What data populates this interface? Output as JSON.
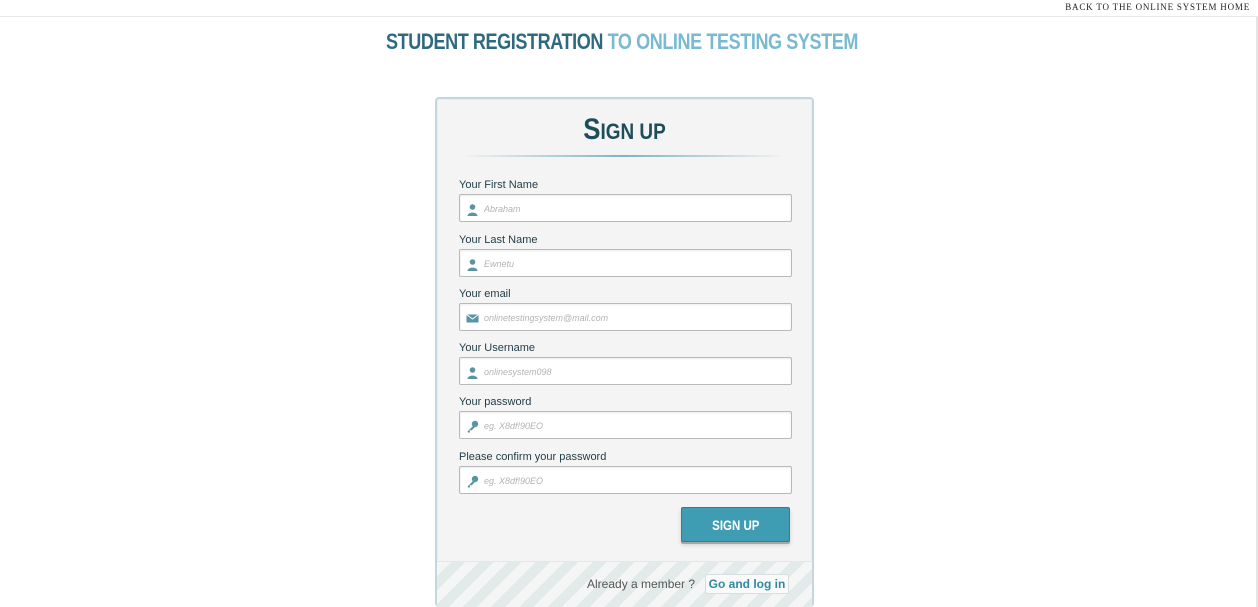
{
  "topbar": {
    "back_link": "BACK TO THE ONLINE SYSTEM HOME"
  },
  "header": {
    "title_part1": "STUDENT REGISTRATION",
    "title_part2": "TO ONLINE TESTING SYSTEM"
  },
  "form": {
    "title_big": "S",
    "title_rest": "IGN UP",
    "fields": [
      {
        "label": "Your First Name",
        "placeholder": "Abraham",
        "icon": "user-icon"
      },
      {
        "label": "Your Last Name",
        "placeholder": "Ewnetu",
        "icon": "user-icon"
      },
      {
        "label": "Your email",
        "placeholder": "onlinetestingsystem@mail.com",
        "icon": "mail-icon"
      },
      {
        "label": "Your Username",
        "placeholder": "onlinesystem098",
        "icon": "user-icon"
      },
      {
        "label": "Your password",
        "placeholder": "eg. X8df!90EO",
        "icon": "key-icon"
      },
      {
        "label": "Please confirm your password",
        "placeholder": "eg. X8df!90EO",
        "icon": "key-icon"
      }
    ],
    "submit_label": "SIGN UP"
  },
  "footer": {
    "member_text": "Already a member ?",
    "login_label": "Go and log in"
  },
  "colors": {
    "accent": "#3e9db3",
    "title_dark": "#2d6a80",
    "title_light": "#77bad2",
    "icon": "#5a93a6"
  }
}
